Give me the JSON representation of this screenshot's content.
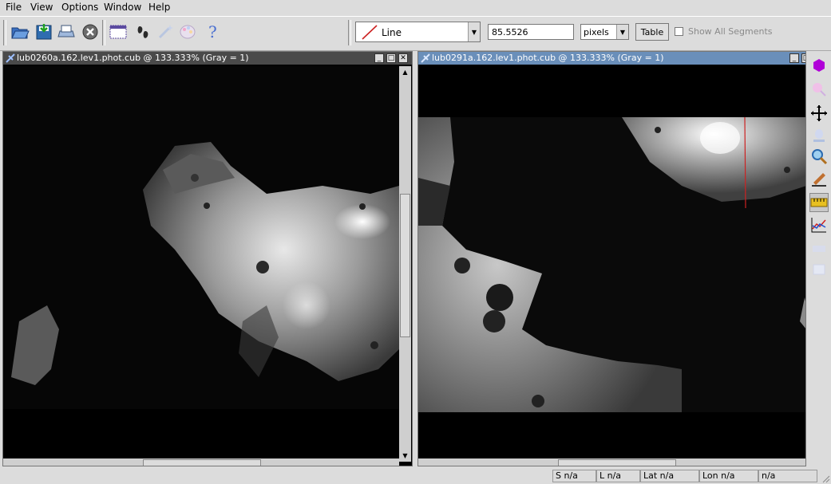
{
  "menu": [
    "File",
    "View",
    "Options",
    "Window",
    "Help"
  ],
  "toolbar": {
    "tool_name": "Line",
    "measure_value": "85.5526",
    "units": "pixels",
    "table_label": "Table",
    "show_all_label": "Show All Segments"
  },
  "windows": [
    {
      "title": "lub0260a.162.lev1.phot.cub @ 133.333% (Gray = 1)"
    },
    {
      "title": "lub0291a.162.lev1.phot.cub @ 133.333% (Gray = 1)"
    }
  ],
  "status": {
    "sample": "S n/a",
    "line": "L n/a",
    "lat": "Lat n/a",
    "lon": "Lon n/a",
    "dn": "n/a"
  },
  "colors": {
    "active_title": "#6a8fba",
    "inactive_title": "#4a4a4a",
    "measure_line": "#cc2222"
  }
}
